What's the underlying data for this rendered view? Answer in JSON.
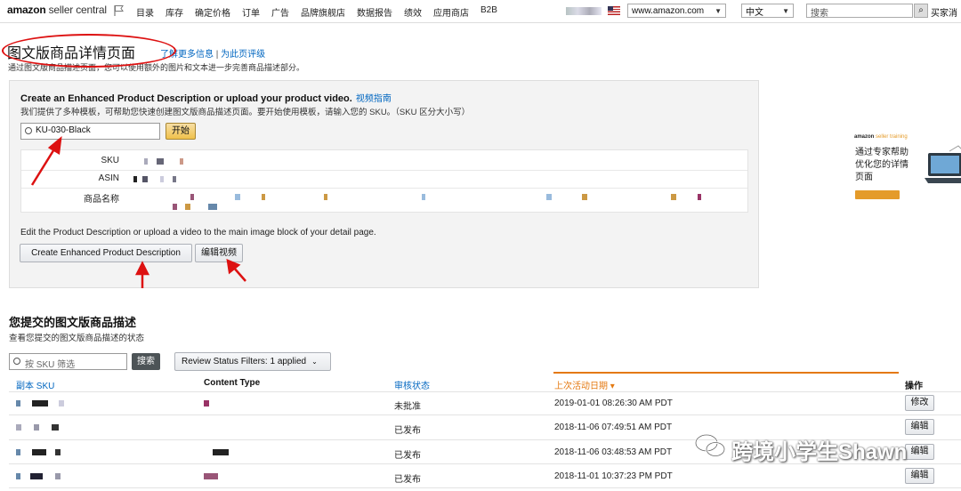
{
  "topbar": {
    "logo_main": "amazon",
    "logo_sub": " seller central",
    "nav": [
      "目录",
      "库存",
      "确定价格",
      "订单",
      "广告",
      "品牌旗舰店",
      "数据报告",
      "绩效",
      "应用商店",
      "B2B"
    ],
    "marketplace": "www.amazon.com",
    "language": "中文",
    "search_placeholder": "搜索",
    "right_text": "买家消"
  },
  "header": {
    "title": "图文版商品详情页面",
    "link_more": "了解更多信息",
    "link_rate": "为此页评级",
    "separator": "|",
    "subtitle": "通过图文版商品描述页面，您可以使用额外的图片和文本进一步完善商品描述部分。"
  },
  "panel": {
    "heading": "Create an Enhanced Product Description or upload your product video.",
    "guide_link": "视频指南",
    "description": "我们提供了多种模板，可帮助您快速创建图文版商品描述页面。要开始使用模板，请输入您的 SKU。（SKU 区分大小写）",
    "sku_value": "KU-030-Black",
    "start_button": "开始",
    "info_labels": [
      "SKU",
      "ASIN",
      "商品名称"
    ],
    "edit_desc": "Edit the Product Description or upload a video to the main image block of your detail page.",
    "create_button": "Create Enhanced Product Description",
    "edit_video_button": "编辑视频"
  },
  "ad": {
    "logo": "amazon",
    "logo_sub": "seller training",
    "text": "通过专家帮助优化您的详情页面"
  },
  "submitted": {
    "title": "您提交的图文版商品描述",
    "description": "查看您提交的图文版商品描述的状态",
    "filter_placeholder": "按 SKU 筛选",
    "search_button": "搜索",
    "review_filter": "Review Status Filters: 1 applied",
    "columns": [
      "副本 SKU",
      "Content Type",
      "审核状态",
      "上次活动日期",
      "操作"
    ],
    "rows": [
      {
        "status": "未批准",
        "date": "2019-01-01 08:26:30 AM PDT",
        "action": "修改"
      },
      {
        "status": "已发布",
        "date": "2018-11-06 07:49:51 AM PDT",
        "action": "编辑"
      },
      {
        "status": "已发布",
        "date": "2018-11-06 03:48:53 AM PDT",
        "action": "编辑"
      },
      {
        "status": "已发布",
        "date": "2018-11-01 10:37:23 PM PDT",
        "action": "编辑"
      }
    ]
  },
  "watermark": "跨境小学生Shawn",
  "colors": {
    "link": "#0066c0",
    "sort": "#e47911",
    "annotation": "#dd1111",
    "button_primary": "#f0c14b"
  }
}
